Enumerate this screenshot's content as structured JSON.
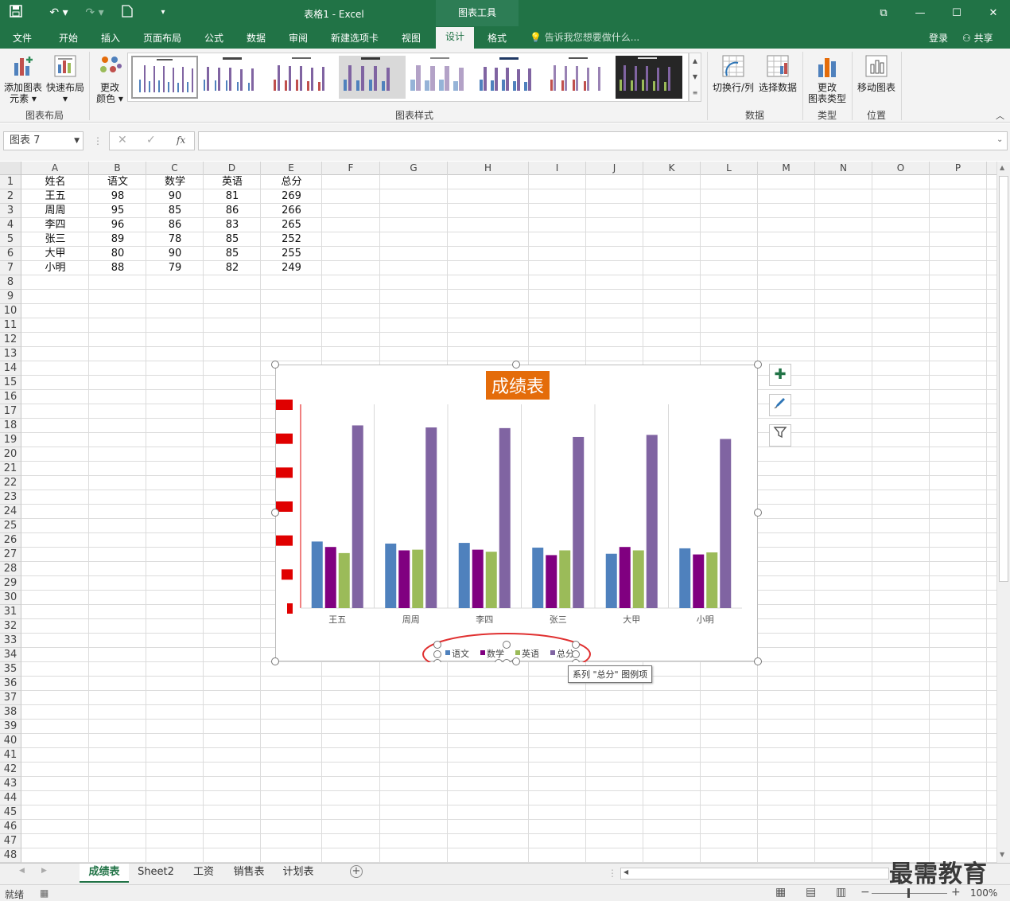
{
  "titlebar": {
    "title": "表格1 - Excel",
    "context_tab": "图表工具"
  },
  "tabs": [
    "文件",
    "开始",
    "插入",
    "页面布局",
    "公式",
    "数据",
    "审阅",
    "新建选项卡",
    "视图",
    "设计",
    "格式"
  ],
  "tellme": "告诉我您想要做什么...",
  "account": {
    "login": "登录",
    "share": "共享"
  },
  "ribbon": {
    "add_element": [
      "添加图表",
      "元素"
    ],
    "quick_layout": "快速布局",
    "change_color": [
      "更改",
      "颜色"
    ],
    "group_layout": "图表布局",
    "group_styles": "图表样式",
    "switch_rowcol": "切换行/列",
    "select_data": "选择数据",
    "group_data": "数据",
    "change_type": [
      "更改",
      "图表类型"
    ],
    "group_type": "类型",
    "move_chart": "移动图表",
    "group_location": "位置"
  },
  "formula": {
    "namebox": "图表 7",
    "fx": "fx",
    "value": ""
  },
  "columns": [
    "A",
    "B",
    "C",
    "D",
    "E",
    "F",
    "G",
    "H",
    "I",
    "J",
    "K",
    "L",
    "M",
    "N",
    "O",
    "P"
  ],
  "rows": [
    "1",
    "2",
    "3",
    "4",
    "5",
    "6",
    "7",
    "8",
    "9",
    "10",
    "11",
    "12",
    "13",
    "14",
    "15",
    "16",
    "17",
    "18",
    "19",
    "20",
    "21",
    "22",
    "23",
    "24",
    "25",
    "26",
    "27",
    "28",
    "29",
    "30",
    "31",
    "32",
    "33",
    "34",
    "35",
    "36",
    "37",
    "38",
    "39",
    "40",
    "41",
    "42",
    "43",
    "44",
    "45",
    "46",
    "47",
    "48"
  ],
  "table": {
    "header": [
      "姓名",
      "语文",
      "数学",
      "英语",
      "总分"
    ],
    "rows": [
      [
        "王五",
        "98",
        "90",
        "81",
        "269"
      ],
      [
        "周周",
        "95",
        "85",
        "86",
        "266"
      ],
      [
        "李四",
        "96",
        "86",
        "83",
        "265"
      ],
      [
        "张三",
        "89",
        "78",
        "85",
        "252"
      ],
      [
        "大甲",
        "80",
        "90",
        "85",
        "255"
      ],
      [
        "小明",
        "88",
        "79",
        "82",
        "249"
      ]
    ]
  },
  "chart_data": {
    "type": "bar",
    "title": "成绩表",
    "categories": [
      "王五",
      "周周",
      "李四",
      "张三",
      "大甲",
      "小明"
    ],
    "series": [
      {
        "name": "语文",
        "color": "#4f81bd",
        "values": [
          98,
          95,
          96,
          89,
          80,
          88
        ]
      },
      {
        "name": "数学",
        "color": "#800080",
        "values": [
          90,
          85,
          86,
          78,
          90,
          79
        ]
      },
      {
        "name": "英语",
        "color": "#9bbb59",
        "values": [
          81,
          86,
          83,
          85,
          85,
          82
        ]
      },
      {
        "name": "总分",
        "color": "#8064a2",
        "values": [
          269,
          266,
          265,
          252,
          255,
          249
        ]
      }
    ],
    "ylim": [
      0,
      300
    ],
    "yticks": [
      "0",
      "50",
      "100",
      "150",
      "200",
      "250",
      "300"
    ],
    "gridlines": "vertical",
    "legend": "bottom"
  },
  "tooltip": "系列 \"总分\" 图例项",
  "sheets": [
    "成绩表",
    "Sheet2",
    "工资",
    "销售表",
    "计划表"
  ],
  "status": {
    "ready": "就绪",
    "zoom": "100%"
  },
  "watermark": "最需教育",
  "colors": {
    "excel_green": "#217346",
    "title_bg": "#e46c0a",
    "ytick_bg": "#e00000",
    "legend_circle": "#e03030"
  }
}
